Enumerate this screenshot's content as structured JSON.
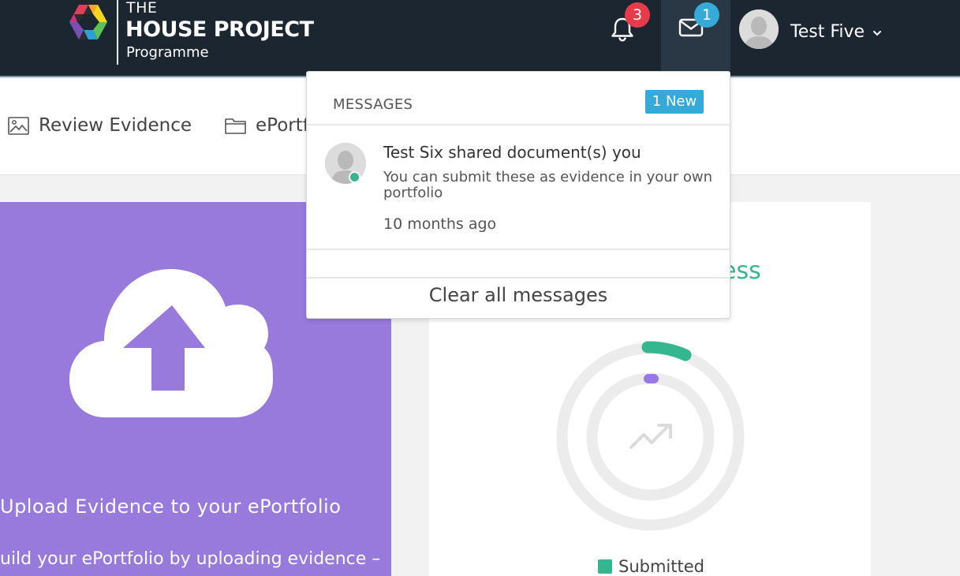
{
  "header": {
    "logo": {
      "the": "THE",
      "main": "HOUSE PROJECT",
      "sub": "Programme"
    },
    "notifications_count": "3",
    "messages_count": "1",
    "user_name": "Test Five"
  },
  "nav": {
    "items": [
      {
        "label": "Review Evidence",
        "icon": "image-icon"
      },
      {
        "label": "ePortf",
        "icon": "folder-icon"
      }
    ]
  },
  "upload_card": {
    "title": "Upload Evidence to your ePortfolio",
    "description": "uild your ePortfolio by uploading evidence –"
  },
  "progress_card": {
    "title_fragment": "ess",
    "legend": [
      {
        "label": "Submitted",
        "color": "#34b68e"
      }
    ]
  },
  "messages_dropdown": {
    "title": "MESSAGES",
    "new_badge": "1 New",
    "items": [
      {
        "title": "Test Six shared document(s) you",
        "body": "You can submit these as evidence in your own portfolio",
        "time": "10 months ago"
      }
    ],
    "clear_label": "Clear all messages"
  },
  "colors": {
    "header_bg": "#1b2631",
    "accent_green": "#34b68e",
    "accent_purple": "#9879dc",
    "badge_red": "#e53b4b",
    "badge_blue": "#35a9d8"
  }
}
